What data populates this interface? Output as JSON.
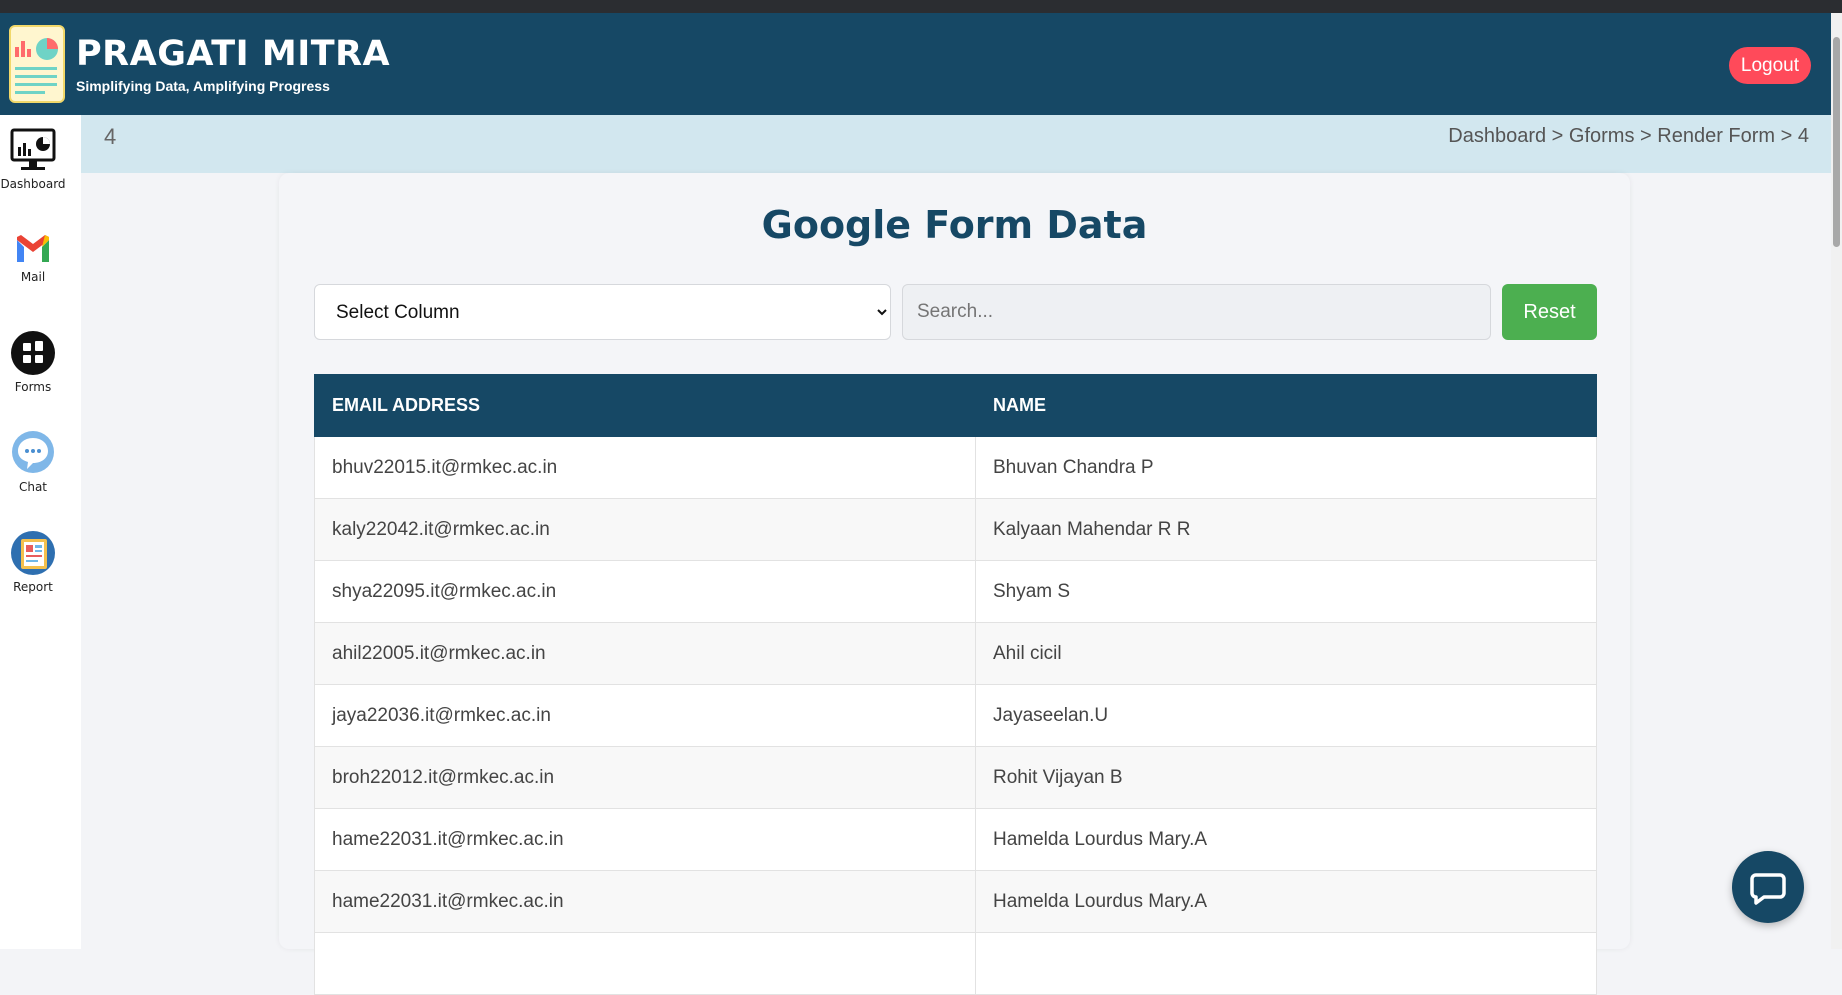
{
  "header": {
    "title": "PRAGATI MITRA",
    "subtitle": "Simplifying Data, Amplifying Progress",
    "logout_label": "Logout"
  },
  "sidebar": {
    "items": [
      {
        "label": "Dashboard",
        "icon": "dashboard-monitor-icon"
      },
      {
        "label": "Mail",
        "icon": "gmail-icon"
      },
      {
        "label": "Forms",
        "icon": "forms-grid-icon"
      },
      {
        "label": "Chat",
        "icon": "chat-bubble-icon"
      },
      {
        "label": "Report",
        "icon": "report-icon"
      }
    ]
  },
  "subheader": {
    "page_id": "4",
    "breadcrumb": [
      "Dashboard",
      "Gforms",
      "Render Form",
      "4"
    ],
    "separator": " > "
  },
  "main": {
    "title": "Google Form Data",
    "select_column_value": "Select Column",
    "search_placeholder": "Search...",
    "reset_label": "Reset"
  },
  "table": {
    "headers": [
      "EMAIL ADDRESS",
      "NAME"
    ],
    "rows": [
      [
        "bhuv22015.it@rmkec.ac.in",
        "Bhuvan Chandra P"
      ],
      [
        "kaly22042.it@rmkec.ac.in",
        "Kalyaan Mahendar R R"
      ],
      [
        "shya22095.it@rmkec.ac.in",
        "Shyam S"
      ],
      [
        "ahil22005.it@rmkec.ac.in",
        "Ahil cicil"
      ],
      [
        "jaya22036.it@rmkec.ac.in",
        "Jayaseelan.U"
      ],
      [
        "broh22012.it@rmkec.ac.in",
        "Rohit Vijayan B"
      ],
      [
        "hame22031.it@rmkec.ac.in",
        "Hamelda Lourdus Mary.A"
      ],
      [
        "hame22031.it@rmkec.ac.in",
        "Hamelda Lourdus Mary.A"
      ],
      [
        "",
        ""
      ]
    ]
  },
  "colors": {
    "primary": "#164865",
    "logout": "#ff4a5a",
    "reset": "#4caf50",
    "subheader_bg": "#d2e7ef"
  }
}
